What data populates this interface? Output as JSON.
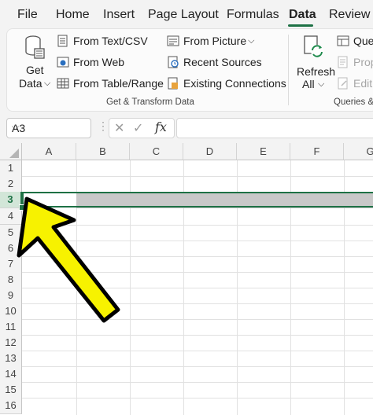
{
  "tabs": {
    "file": "File",
    "home": "Home",
    "insert": "Insert",
    "page_layout": "Page Layout",
    "formulas": "Formulas",
    "data": "Data",
    "review": "Review"
  },
  "ribbon": {
    "get_data": {
      "line1": "Get",
      "line2": "Data",
      "chevron": "⌄"
    },
    "from_text_csv": "From Text/CSV",
    "from_web": "From Web",
    "from_table_range": "From Table/Range",
    "from_picture": "From Picture",
    "recent_sources": "Recent Sources",
    "existing_connections": "Existing Connections",
    "group1_label": "Get & Transform Data",
    "refresh": {
      "line1": "Refresh",
      "line2": "All"
    },
    "queries": "Que",
    "properties": "Prop",
    "edit_links": "Edit",
    "group2_label": "Queries &"
  },
  "formula_bar": {
    "name_box": "A3",
    "cancel": "✕",
    "enter": "✓",
    "fx": "fx",
    "value": ""
  },
  "grid": {
    "columns": [
      "A",
      "B",
      "C",
      "D",
      "E",
      "F",
      "G"
    ],
    "rows": [
      "1",
      "2",
      "3",
      "4",
      "5",
      "6",
      "7",
      "8",
      "9",
      "10",
      "11",
      "12",
      "13",
      "14",
      "15",
      "16"
    ],
    "selected_row": "3"
  },
  "colors": {
    "accent": "#1e7145",
    "arrow_fill": "#f7f200",
    "selection_fill": "#c8c8c8"
  }
}
